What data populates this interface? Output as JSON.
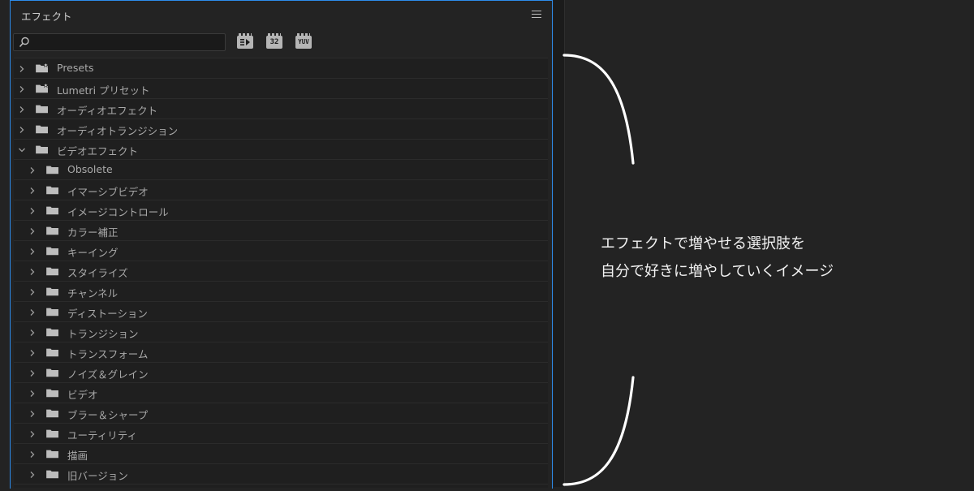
{
  "panel": {
    "title": "エフェクト",
    "search": {
      "value": "",
      "placeholder": ""
    },
    "filters": [
      {
        "icon": "accelerated-effects-icon"
      },
      {
        "label": "32"
      },
      {
        "label": "YUV"
      }
    ]
  },
  "tree": {
    "top_level": [
      {
        "label": "Presets",
        "expanded": false,
        "icon": "preset-folder-icon"
      },
      {
        "label": "Lumetri プリセット",
        "expanded": false,
        "icon": "preset-folder-icon"
      },
      {
        "label": "オーディオエフェクト",
        "expanded": false,
        "icon": "folder-icon"
      },
      {
        "label": "オーディオトランジション",
        "expanded": false,
        "icon": "folder-icon"
      },
      {
        "label": "ビデオエフェクト",
        "expanded": true,
        "icon": "folder-icon"
      }
    ],
    "video_effects_children": [
      "Obsolete",
      "イマーシブビデオ",
      "イメージコントロール",
      "カラー補正",
      "キーイング",
      "スタイライズ",
      "チャンネル",
      "ディストーション",
      "トランジション",
      "トランスフォーム",
      "ノイズ＆グレイン",
      "ビデオ",
      "ブラー＆シャープ",
      "ユーティリティ",
      "描画",
      "旧バージョン"
    ]
  },
  "caption": {
    "line1": "エフェクトで増やせる選択肢を",
    "line2": "自分で好きに増やしていくイメージ"
  },
  "colors": {
    "background": "#232323",
    "panel_border": "#2d8ceb",
    "text": "#a9a9a9",
    "caption": "#f2f2f2"
  }
}
